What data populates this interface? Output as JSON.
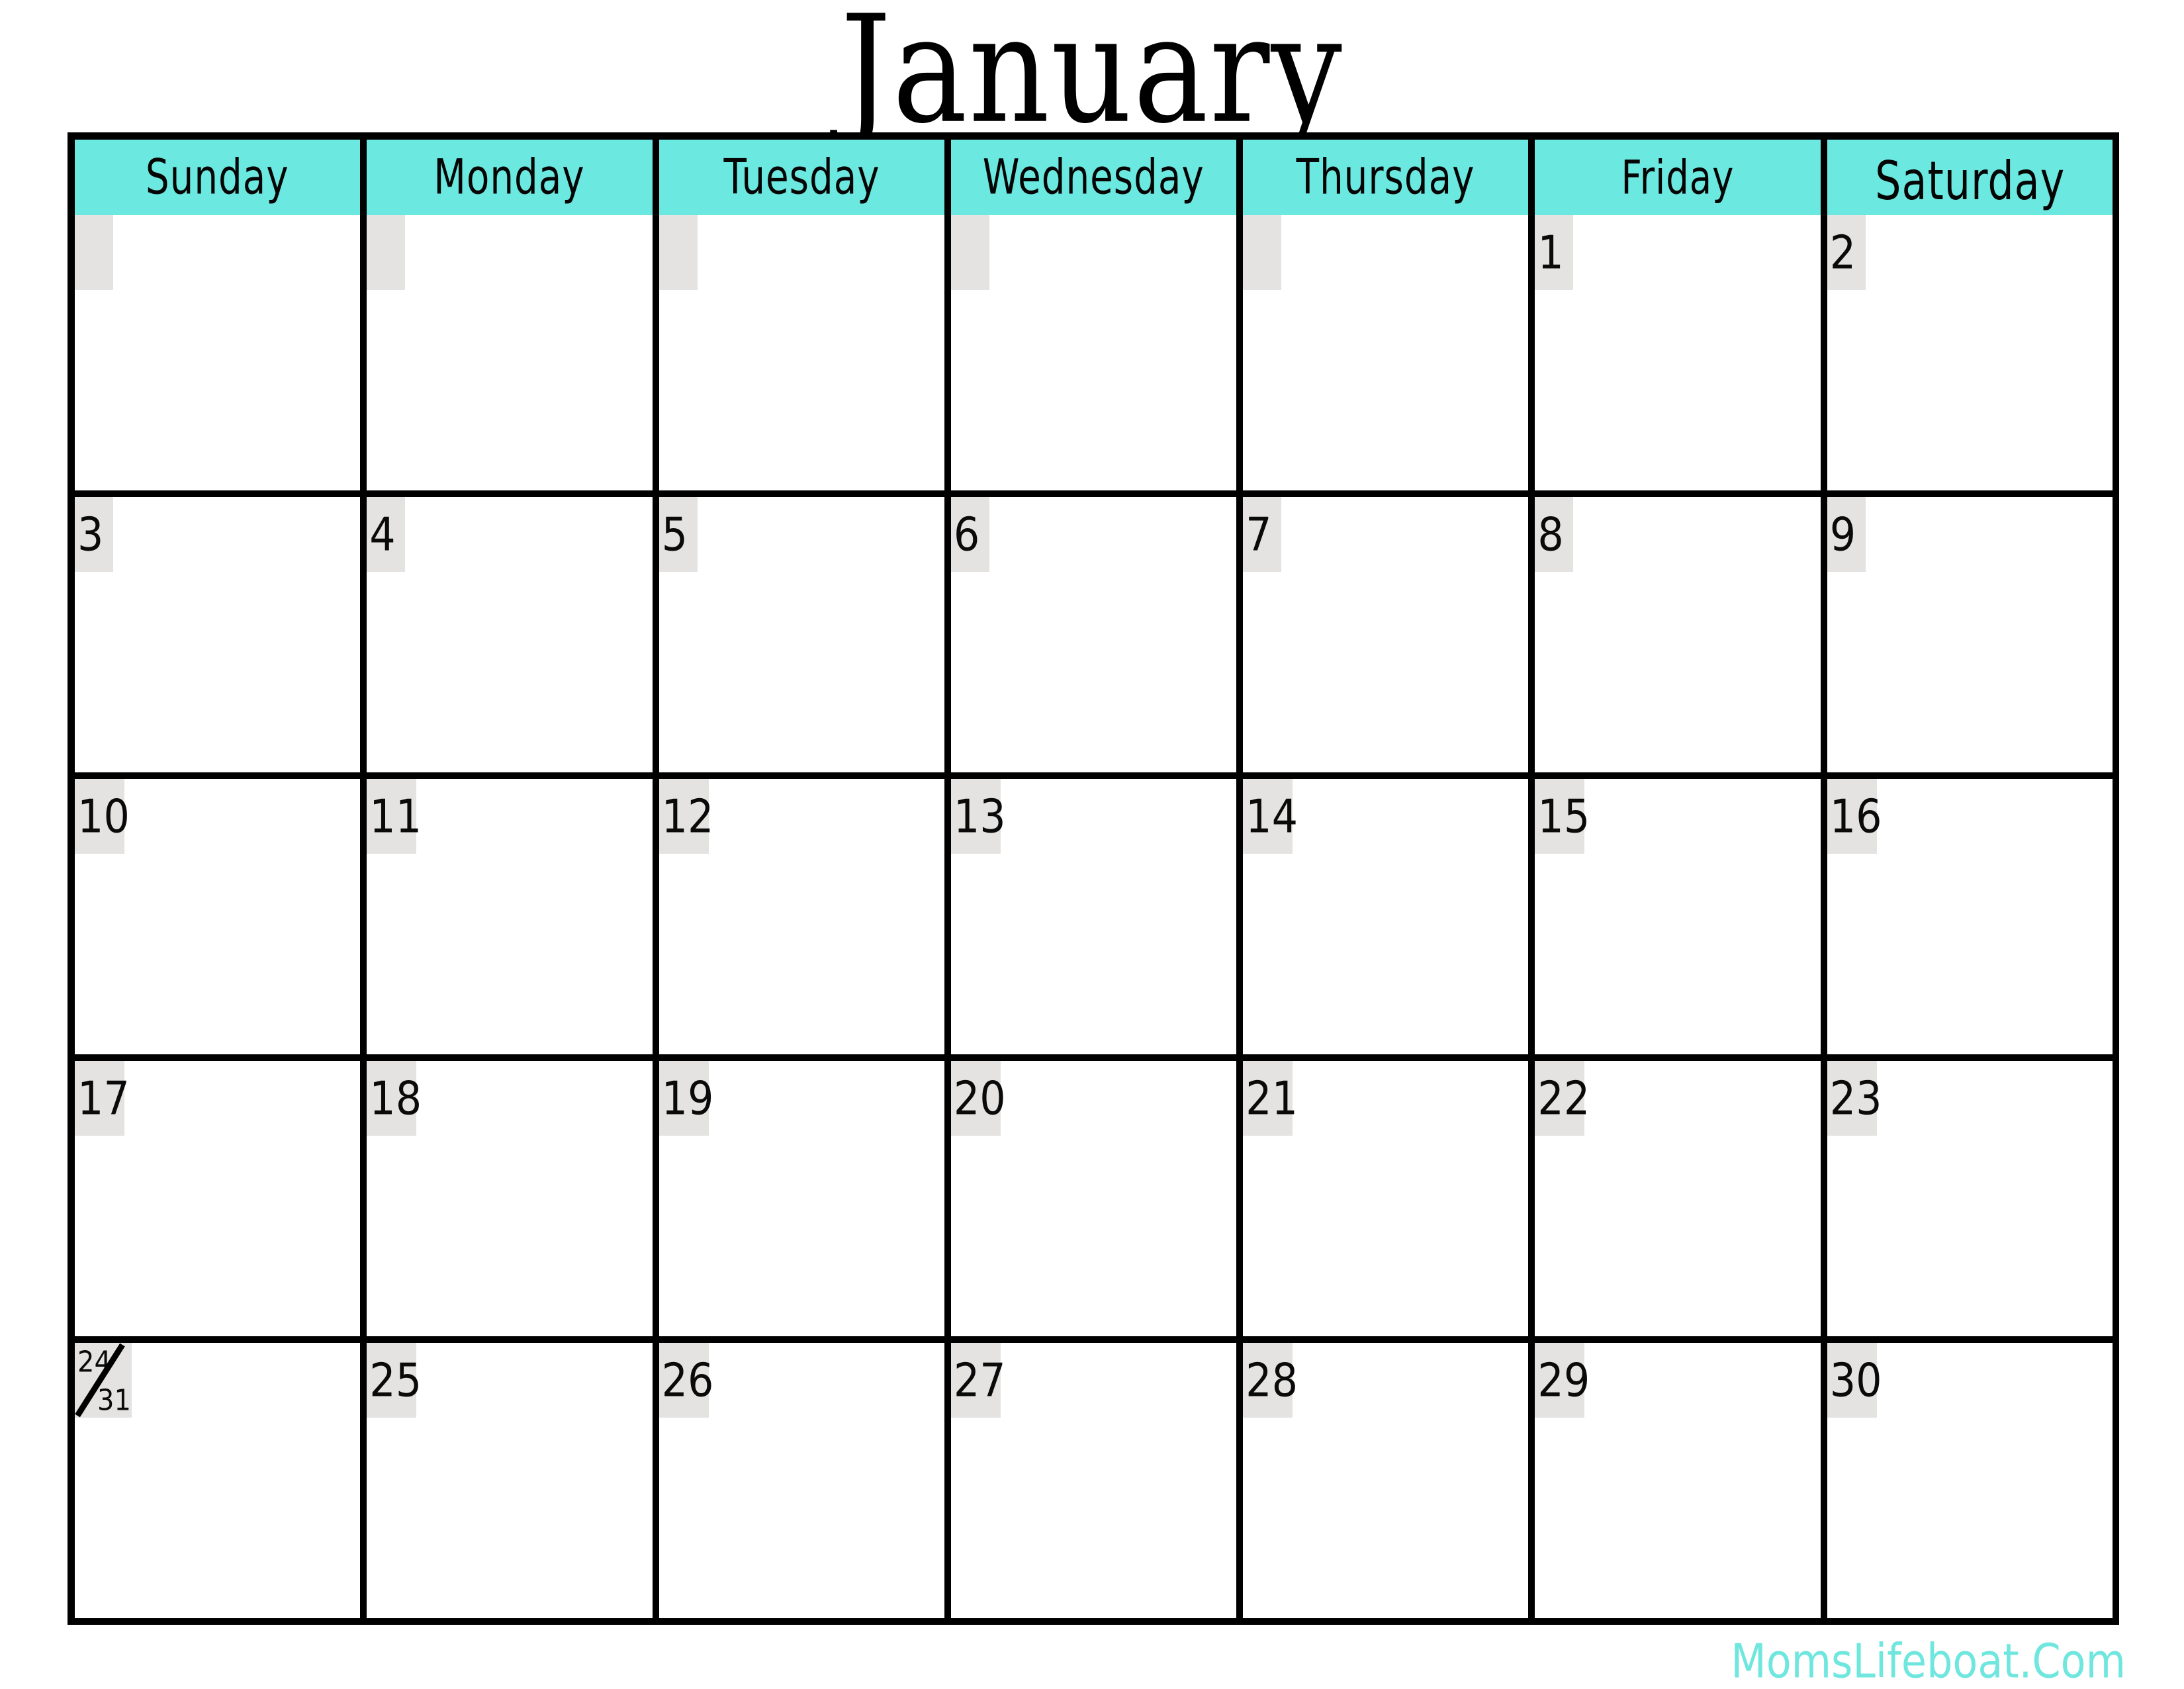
{
  "title": {
    "month": "January"
  },
  "colors": {
    "header_background": "#6BE8E0",
    "date_chip_background": "#E4E3E1",
    "grid_line": "#000000",
    "text": "#000000",
    "credit_text": "#6FE6DE",
    "page_background": "#FFFFFF"
  },
  "weekdays": [
    {
      "label": "Sunday"
    },
    {
      "label": "Monday"
    },
    {
      "label": "Tuesday"
    },
    {
      "label": "Wednesday"
    },
    {
      "label": "Thursday"
    },
    {
      "label": "Friday"
    },
    {
      "label": "Saturday"
    }
  ],
  "weeks": [
    [
      {
        "number": ""
      },
      {
        "number": ""
      },
      {
        "number": ""
      },
      {
        "number": ""
      },
      {
        "number": ""
      },
      {
        "number": "1"
      },
      {
        "number": "2"
      }
    ],
    [
      {
        "number": "3"
      },
      {
        "number": "4"
      },
      {
        "number": "5"
      },
      {
        "number": "6"
      },
      {
        "number": "7"
      },
      {
        "number": "8"
      },
      {
        "number": "9"
      }
    ],
    [
      {
        "number": "10"
      },
      {
        "number": "11"
      },
      {
        "number": "12"
      },
      {
        "number": "13"
      },
      {
        "number": "14"
      },
      {
        "number": "15"
      },
      {
        "number": "16"
      }
    ],
    [
      {
        "number": "17"
      },
      {
        "number": "18"
      },
      {
        "number": "19"
      },
      {
        "number": "20"
      },
      {
        "number": "21"
      },
      {
        "number": "22"
      },
      {
        "number": "23"
      }
    ],
    [
      {
        "number_top": "24",
        "number_bottom": "31",
        "split": true
      },
      {
        "number": "25"
      },
      {
        "number": "26"
      },
      {
        "number": "27"
      },
      {
        "number": "28"
      },
      {
        "number": "29"
      },
      {
        "number": "30"
      }
    ]
  ],
  "footer": {
    "credit": "MomsLifeboat.Com"
  }
}
